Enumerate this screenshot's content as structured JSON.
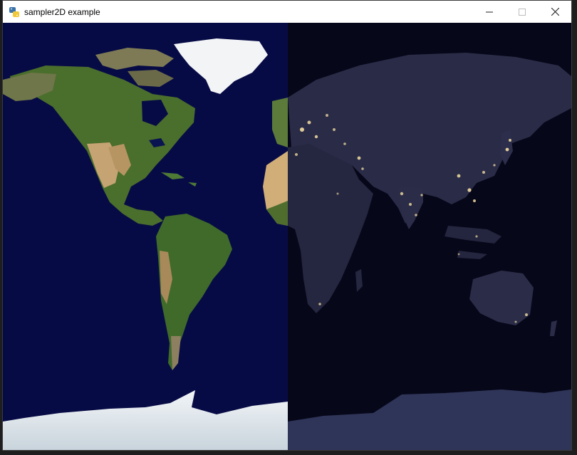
{
  "window": {
    "title": "sampler2D example",
    "icon": "python-logo-icon",
    "controls": {
      "minimize_icon": "minimize-icon",
      "maximize_icon": "maximize-icon",
      "close_icon": "close-icon"
    }
  },
  "scene": {
    "left_half": "daytime-earth-texture",
    "right_half": "nighttime-earth-texture",
    "colors": {
      "ocean_day": "#070b45",
      "ocean_night": "#07071a",
      "land_green": "#3f6a2a",
      "land_desert": "#c9a876",
      "ice": "#e8edf2",
      "night_land": "#2a2b47",
      "night_antarctica": "#2f3558",
      "city_lights": "#ffe9a8"
    }
  }
}
